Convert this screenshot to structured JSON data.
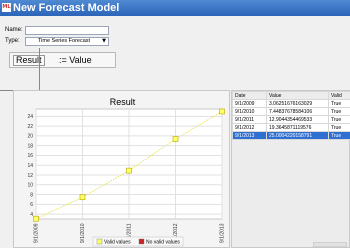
{
  "window": {
    "title": "New Forecast Model",
    "icon": "app-icon",
    "icon_glyph": "ML"
  },
  "form": {
    "name_label": "Name:",
    "name_value": "",
    "type_label": "Type:",
    "type_value": "Time Series Forecast"
  },
  "formula": {
    "result_button": "Result",
    "assignment": ":= Value"
  },
  "chart": {
    "title": "Result",
    "legend": [
      {
        "label": "Valid values",
        "color": "#ffff66"
      },
      {
        "label": "No valid values",
        "color": "#cc2222"
      }
    ]
  },
  "chart_data": {
    "type": "line",
    "title": "Result",
    "x": [
      "9/1/2009",
      "9/1/2010",
      "9/1/2011",
      "9/1/2012",
      "9/1/2013"
    ],
    "series": [
      {
        "name": "Valid values",
        "values": [
          3.06,
          7.45,
          12.9,
          19.36,
          25.0
        ]
      }
    ],
    "yticks": [
      4,
      6,
      8,
      10,
      12,
      14,
      16,
      18,
      20,
      22,
      24
    ],
    "ylim": [
      3,
      25.5
    ],
    "grid": true,
    "legend": "bottom"
  },
  "table": {
    "columns": [
      "Date",
      "Value",
      "Valid"
    ],
    "rows": [
      [
        "9/1/2009",
        "3.06251676163029",
        "True"
      ],
      [
        "9/1/2010",
        "7.44837678584106",
        "True"
      ],
      [
        "9/1/2011",
        "12.9044354469533",
        "True"
      ],
      [
        "9/1/2012",
        "19.3645871119576",
        "True"
      ],
      [
        "9/1/2013",
        "25.0004220158791",
        "True"
      ]
    ],
    "selected_row": 4
  }
}
